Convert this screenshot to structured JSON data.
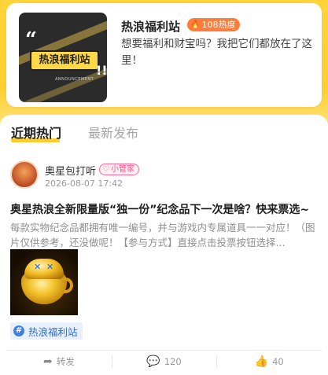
{
  "header": {
    "cover_label": "热浪福利站",
    "cover_subtext": "ANNOUNCEMENT",
    "title": "热浪福利站",
    "heat_badge": "108热度",
    "description": "想要福利和财宝吗？我把它们都放在了这里！",
    "accent_color": "#ffcf2e"
  },
  "tabs": [
    {
      "label": "近期热门",
      "active": true
    },
    {
      "label": "最新发布",
      "active": false
    }
  ],
  "post": {
    "author": "奥星包打听",
    "role_badge": "小管家",
    "time": "2026-08-07 17:42",
    "title": "奥星热浪全新限量版“独一份”纪念品下一次是啥？快来票选~",
    "excerpt": "每款实物纪念品都拥有唯一编号，并与游戏内专属道具一一对应！（图片仅供参考，还没做呢！【参与方式】直接点击投票按钮选择...",
    "image_icon": "golden-cup-image",
    "topic_tag": "热浪福利站",
    "actions": {
      "share_label": "转发",
      "comment_count": "120",
      "like_count": "40"
    }
  }
}
